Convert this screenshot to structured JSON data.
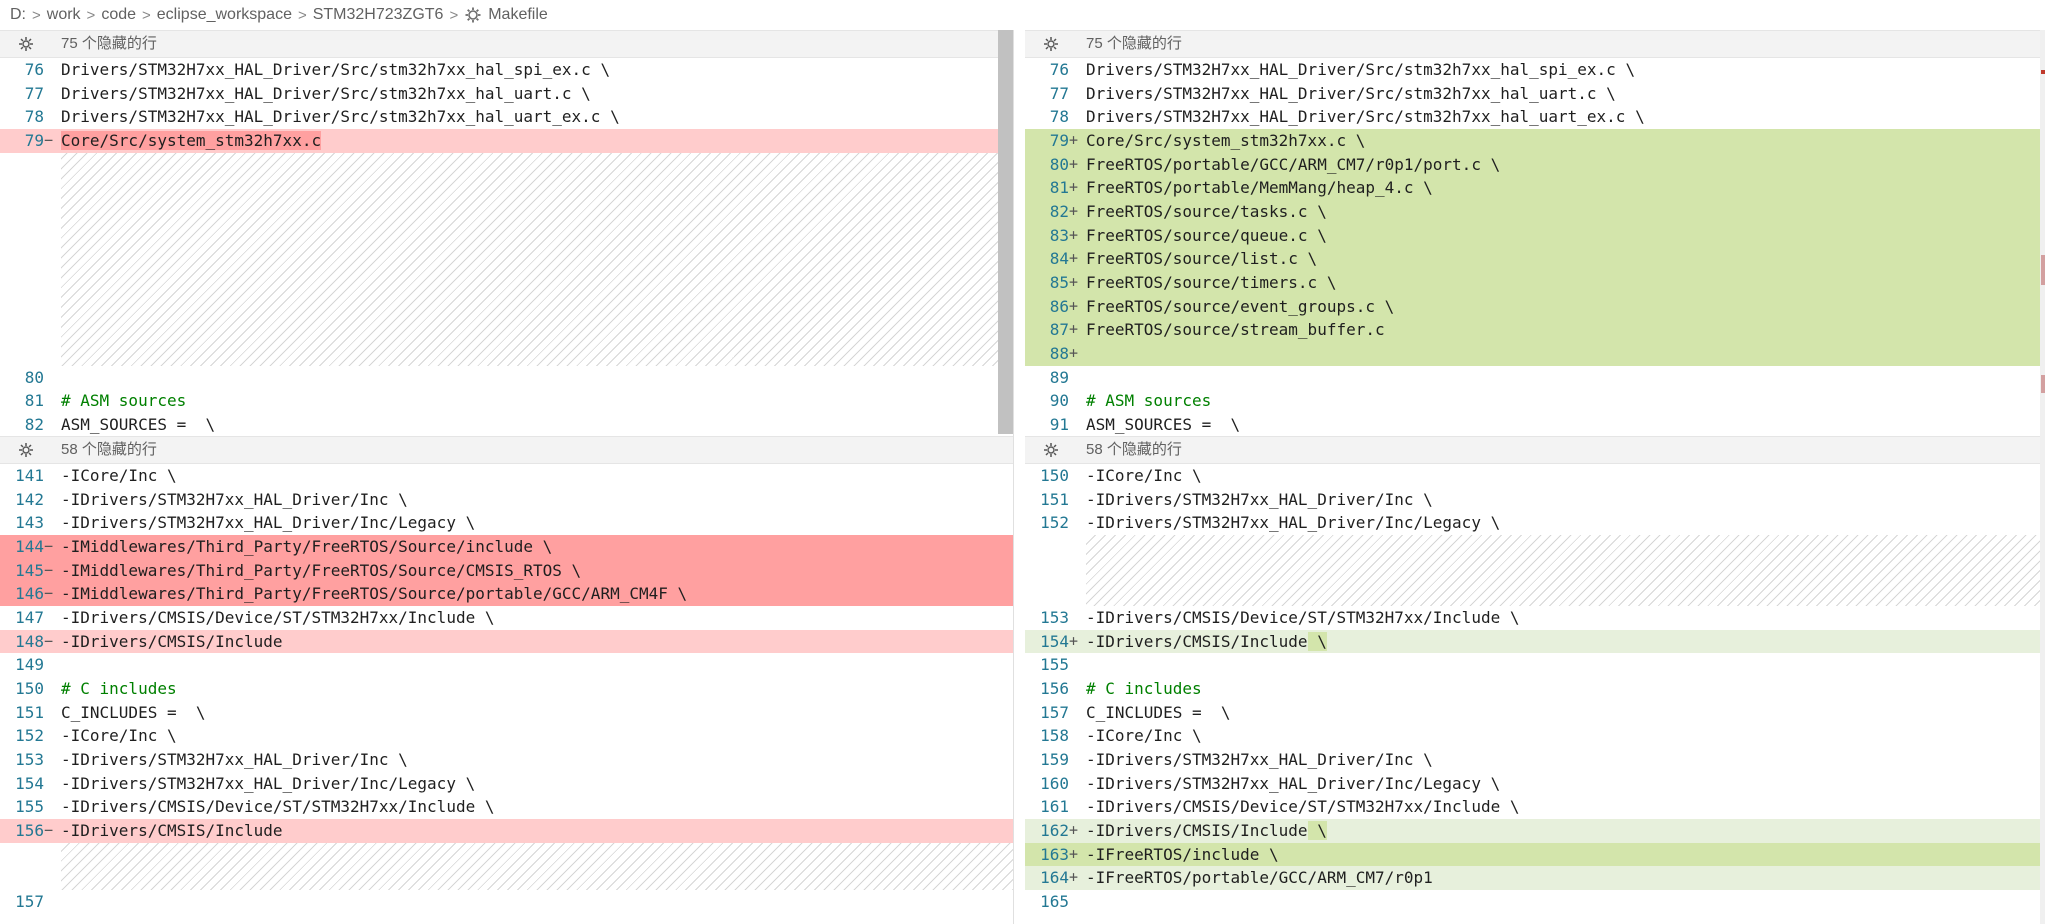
{
  "breadcrumb": {
    "items": [
      "D:",
      "work",
      "code",
      "eclipse_workspace",
      "STM32H723ZGT6"
    ],
    "file_name": "Makefile",
    "separator": ">",
    "file_icon": "makefile-gear-icon"
  },
  "hidden_regions": {
    "top_left": "75 个隐藏的行",
    "top_right": "75 个隐藏的行",
    "bottom_left": "58 个隐藏的行",
    "bottom_right": "58 个隐藏的行"
  },
  "colors": {
    "line_number": "#237893",
    "deleted_line": "#ffcccc",
    "deleted_text": "#ffa0a0",
    "added_line": "#e7f0dc",
    "added_text": "#d3e5ab",
    "comment": "#008000"
  },
  "left_top_lines": [
    {
      "n": "76",
      "m": "",
      "t": "Drivers/STM32H7xx_HAL_Driver/Src/stm32h7xx_hal_spi_ex.c \\"
    },
    {
      "n": "77",
      "m": "",
      "t": "Drivers/STM32H7xx_HAL_Driver/Src/stm32h7xx_hal_uart.c \\"
    },
    {
      "n": "78",
      "m": "",
      "t": "Drivers/STM32H7xx_HAL_Driver/Src/stm32h7xx_hal_uart_ex.c \\"
    },
    {
      "n": "79",
      "m": "−",
      "t": "Core/Src/system_stm32h7xx.c"
    },
    {
      "n": "80",
      "m": "",
      "t": ""
    },
    {
      "n": "81",
      "m": "",
      "t": "# ASM sources"
    },
    {
      "n": "82",
      "m": "",
      "t": "ASM_SOURCES =  \\"
    }
  ],
  "right_top_lines": [
    {
      "n": "76",
      "m": "",
      "t": "Drivers/STM32H7xx_HAL_Driver/Src/stm32h7xx_hal_spi_ex.c \\"
    },
    {
      "n": "77",
      "m": "",
      "t": "Drivers/STM32H7xx_HAL_Driver/Src/stm32h7xx_hal_uart.c \\"
    },
    {
      "n": "78",
      "m": "",
      "t": "Drivers/STM32H7xx_HAL_Driver/Src/stm32h7xx_hal_uart_ex.c \\"
    },
    {
      "n": "79",
      "m": "+",
      "t": "Core/Src/system_stm32h7xx.c",
      "t2": " \\"
    },
    {
      "n": "80",
      "m": "+",
      "t": "FreeRTOS/portable/GCC/ARM_CM7/r0p1/port.c \\"
    },
    {
      "n": "81",
      "m": "+",
      "t": "FreeRTOS/portable/MemMang/heap_4.c \\"
    },
    {
      "n": "82",
      "m": "+",
      "t": "FreeRTOS/source/tasks.c \\"
    },
    {
      "n": "83",
      "m": "+",
      "t": "FreeRTOS/source/queue.c \\"
    },
    {
      "n": "84",
      "m": "+",
      "t": "FreeRTOS/source/list.c \\"
    },
    {
      "n": "85",
      "m": "+",
      "t": "FreeRTOS/source/timers.c \\"
    },
    {
      "n": "86",
      "m": "+",
      "t": "FreeRTOS/source/event_groups.c \\"
    },
    {
      "n": "87",
      "m": "+",
      "t": "FreeRTOS/source/stream_buffer.c"
    },
    {
      "n": "88",
      "m": "+",
      "t": ""
    },
    {
      "n": "89",
      "m": "",
      "t": ""
    },
    {
      "n": "90",
      "m": "",
      "t": "# ASM sources"
    },
    {
      "n": "91",
      "m": "",
      "t": "ASM_SOURCES =  \\"
    }
  ],
  "left_bottom_lines": [
    {
      "n": "141",
      "m": "",
      "t": "-ICore/Inc \\"
    },
    {
      "n": "142",
      "m": "",
      "t": "-IDrivers/STM32H7xx_HAL_Driver/Inc \\"
    },
    {
      "n": "143",
      "m": "",
      "t": "-IDrivers/STM32H7xx_HAL_Driver/Inc/Legacy \\"
    },
    {
      "n": "144",
      "m": "−",
      "t": "-IMiddlewares/Third_Party/FreeRTOS/Source/include \\"
    },
    {
      "n": "145",
      "m": "−",
      "t": "-IMiddlewares/Third_Party/FreeRTOS/Source/CMSIS_RTOS \\"
    },
    {
      "n": "146",
      "m": "−",
      "t": "-IMiddlewares/Third_Party/FreeRTOS/Source/portable/GCC/ARM_CM4F \\"
    },
    {
      "n": "147",
      "m": "",
      "t": "-IDrivers/CMSIS/Device/ST/STM32H7xx/Include \\"
    },
    {
      "n": "148",
      "m": "−",
      "t": "-IDrivers/CMSIS/Include"
    },
    {
      "n": "149",
      "m": "",
      "t": ""
    },
    {
      "n": "150",
      "m": "",
      "t": "# C includes"
    },
    {
      "n": "151",
      "m": "",
      "t": "C_INCLUDES =  \\"
    },
    {
      "n": "152",
      "m": "",
      "t": "-ICore/Inc \\"
    },
    {
      "n": "153",
      "m": "",
      "t": "-IDrivers/STM32H7xx_HAL_Driver/Inc \\"
    },
    {
      "n": "154",
      "m": "",
      "t": "-IDrivers/STM32H7xx_HAL_Driver/Inc/Legacy \\"
    },
    {
      "n": "155",
      "m": "",
      "t": "-IDrivers/CMSIS/Device/ST/STM32H7xx/Include \\"
    },
    {
      "n": "156",
      "m": "−",
      "t": "-IDrivers/CMSIS/Include"
    },
    {
      "n": "157",
      "m": "",
      "t": ""
    }
  ],
  "right_bottom_lines": [
    {
      "n": "150",
      "m": "",
      "t": "-ICore/Inc \\"
    },
    {
      "n": "151",
      "m": "",
      "t": "-IDrivers/STM32H7xx_HAL_Driver/Inc \\"
    },
    {
      "n": "152",
      "m": "",
      "t": "-IDrivers/STM32H7xx_HAL_Driver/Inc/Legacy \\"
    },
    {
      "n": "153",
      "m": "",
      "t": "-IDrivers/CMSIS/Device/ST/STM32H7xx/Include \\"
    },
    {
      "n": "154",
      "m": "+",
      "t": "-IDrivers/CMSIS/Include",
      "t2": " \\"
    },
    {
      "n": "155",
      "m": "",
      "t": ""
    },
    {
      "n": "156",
      "m": "",
      "t": "# C includes"
    },
    {
      "n": "157",
      "m": "",
      "t": "C_INCLUDES =  \\"
    },
    {
      "n": "158",
      "m": "",
      "t": "-ICore/Inc \\"
    },
    {
      "n": "159",
      "m": "",
      "t": "-IDrivers/STM32H7xx_HAL_Driver/Inc \\"
    },
    {
      "n": "160",
      "m": "",
      "t": "-IDrivers/STM32H7xx_HAL_Driver/Inc/Legacy \\"
    },
    {
      "n": "161",
      "m": "",
      "t": "-IDrivers/CMSIS/Device/ST/STM32H7xx/Include \\"
    },
    {
      "n": "162",
      "m": "+",
      "t": "-IDrivers/CMSIS/Include",
      "t2": " \\"
    },
    {
      "n": "163",
      "m": "+",
      "t": "-IFreeRTOS/include \\"
    },
    {
      "n": "164",
      "m": "+",
      "t": "-IFreeRTOS/portable/GCC/ARM_CM7/r0p1"
    },
    {
      "n": "165",
      "m": "",
      "t": ""
    }
  ]
}
